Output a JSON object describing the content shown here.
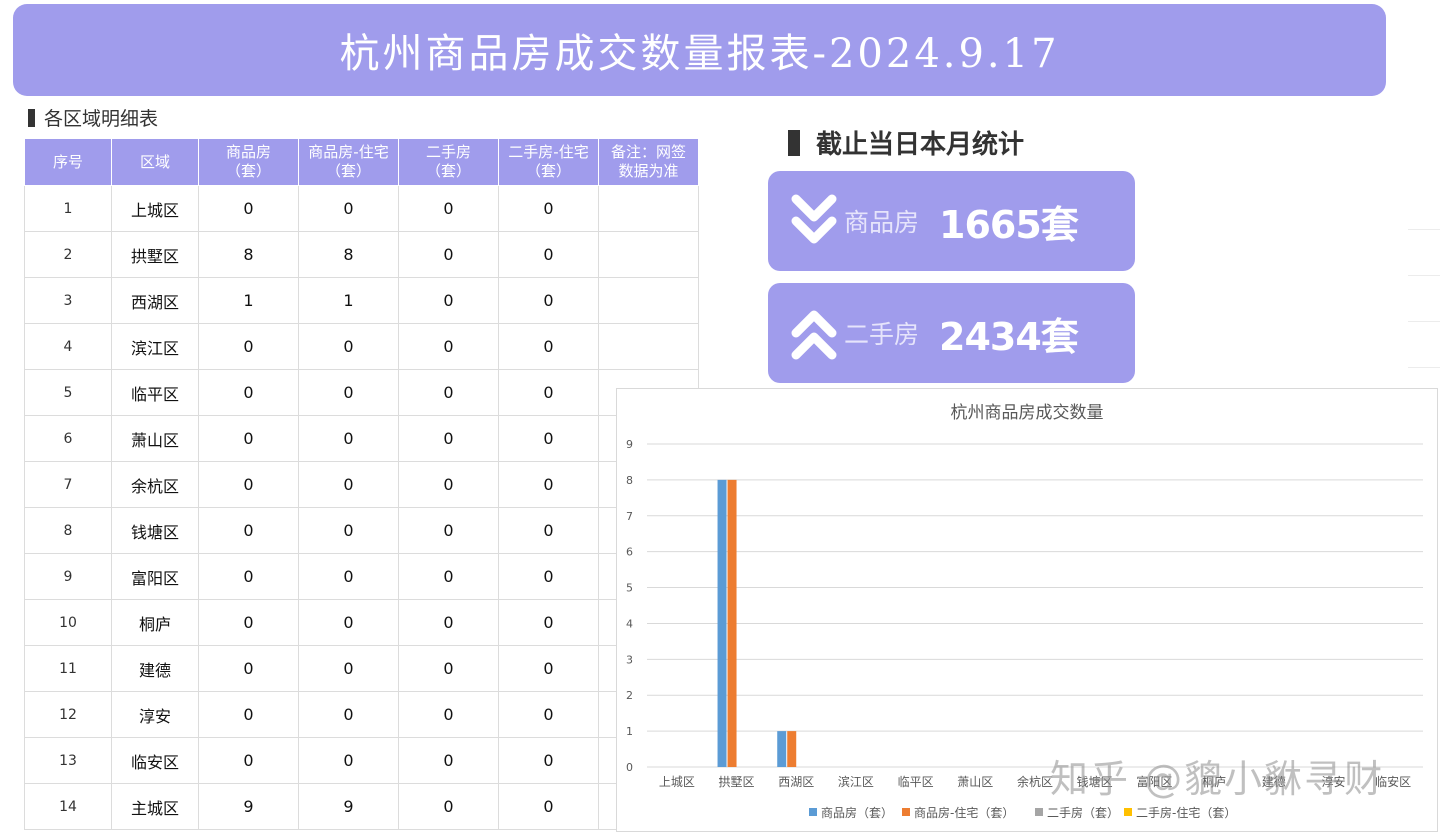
{
  "header": {
    "title": "杭州商品房成交数量报表-2024.9.17"
  },
  "detail": {
    "label": "各区域明细表",
    "columns": [
      "序号",
      "区域",
      "商品房\n（套）",
      "商品房-住宅\n（套）",
      "二手房\n（套）",
      "二手房-住宅\n（套）",
      "备注：网签\n数据为准"
    ],
    "rows": [
      [
        "1",
        "上城区",
        "0",
        "0",
        "0",
        "0",
        ""
      ],
      [
        "2",
        "拱墅区",
        "8",
        "8",
        "0",
        "0",
        ""
      ],
      [
        "3",
        "西湖区",
        "1",
        "1",
        "0",
        "0",
        ""
      ],
      [
        "4",
        "滨江区",
        "0",
        "0",
        "0",
        "0",
        ""
      ],
      [
        "5",
        "临平区",
        "0",
        "0",
        "0",
        "0",
        ""
      ],
      [
        "6",
        "萧山区",
        "0",
        "0",
        "0",
        "0",
        ""
      ],
      [
        "7",
        "余杭区",
        "0",
        "0",
        "0",
        "0",
        ""
      ],
      [
        "8",
        "钱塘区",
        "0",
        "0",
        "0",
        "0",
        ""
      ],
      [
        "9",
        "富阳区",
        "0",
        "0",
        "0",
        "0",
        ""
      ],
      [
        "10",
        "桐庐",
        "0",
        "0",
        "0",
        "0",
        ""
      ],
      [
        "11",
        "建德",
        "0",
        "0",
        "0",
        "0",
        ""
      ],
      [
        "12",
        "淳安",
        "0",
        "0",
        "0",
        "0",
        ""
      ],
      [
        "13",
        "临安区",
        "0",
        "0",
        "0",
        "0",
        ""
      ],
      [
        "14",
        "主城区",
        "9",
        "9",
        "0",
        "0",
        ""
      ]
    ]
  },
  "monthly": {
    "label": "截止当日本月统计",
    "cards": [
      {
        "name": "商品房",
        "value": "1665套",
        "icon": "double-chevron-down-icon"
      },
      {
        "name": "二手房",
        "value": "2434套",
        "icon": "double-chevron-up-icon"
      }
    ]
  },
  "colors": {
    "accent": "#a09cec",
    "series_1": "#5b9bd5",
    "series_2": "#ed7d31",
    "series_3": "#a5a5a5",
    "series_4": "#ffc000"
  },
  "chart_data": {
    "type": "bar",
    "title": "杭州商品房成交数量",
    "categories": [
      "上城区",
      "拱墅区",
      "西湖区",
      "滨江区",
      "临平区",
      "萧山区",
      "余杭区",
      "钱塘区",
      "富阳区",
      "桐庐",
      "建德",
      "淳安",
      "临安区"
    ],
    "series": [
      {
        "name": "商品房（套）",
        "values": [
          0,
          8,
          1,
          0,
          0,
          0,
          0,
          0,
          0,
          0,
          0,
          0,
          0
        ]
      },
      {
        "name": "商品房-住宅（套）",
        "values": [
          0,
          8,
          1,
          0,
          0,
          0,
          0,
          0,
          0,
          0,
          0,
          0,
          0
        ]
      },
      {
        "name": "二手房（套）",
        "values": [
          0,
          0,
          0,
          0,
          0,
          0,
          0,
          0,
          0,
          0,
          0,
          0,
          0
        ]
      },
      {
        "name": "二手房-住宅（套）",
        "values": [
          0,
          0,
          0,
          0,
          0,
          0,
          0,
          0,
          0,
          0,
          0,
          0,
          0
        ]
      }
    ],
    "ylim": [
      0,
      9
    ],
    "yticks": [
      0,
      1,
      2,
      3,
      4,
      5,
      6,
      7,
      8,
      9
    ],
    "grid": true,
    "legend": "bottom"
  },
  "watermark": "知乎 @貔小貅寻财"
}
